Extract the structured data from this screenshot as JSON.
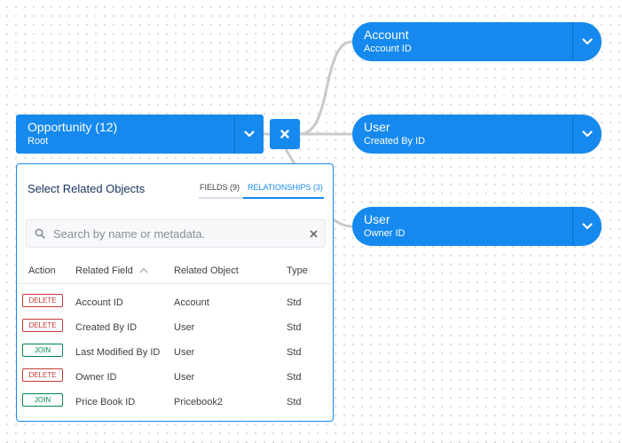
{
  "root_node": {
    "title": "Opportunity (12)",
    "subtitle": "Root"
  },
  "child_nodes": [
    {
      "title": "Account",
      "subtitle": "Account ID"
    },
    {
      "title": "User",
      "subtitle": "Created By ID"
    },
    {
      "title": "User",
      "subtitle": "Owner ID"
    }
  ],
  "panel": {
    "title": "Select Related Objects",
    "tabs": {
      "fields": "FIELDS (9)",
      "relationships": "RELATIONSHIPS (3)",
      "active": "relationships"
    },
    "search": {
      "placeholder": "Search by name or metadata.",
      "value": ""
    },
    "columns": {
      "action": "Action",
      "field": "Related Field",
      "object": "Related Object",
      "type": "Type"
    },
    "sort": {
      "column": "field",
      "direction": "ascending"
    },
    "rows": [
      {
        "action": "DELETE",
        "field": "Account ID",
        "object": "Account",
        "type": "Std"
      },
      {
        "action": "DELETE",
        "field": "Created By ID",
        "object": "User",
        "type": "Std"
      },
      {
        "action": "JOIN",
        "field": "Last Modified By ID",
        "object": "User",
        "type": "Std"
      },
      {
        "action": "DELETE",
        "field": "Owner ID",
        "object": "User",
        "type": "Std"
      },
      {
        "action": "JOIN",
        "field": "Price Book ID",
        "object": "Pricebook2",
        "type": "Std"
      }
    ]
  },
  "icons": {
    "chevron": "chevron-down-icon",
    "remove": "close-icon",
    "search": "search-icon",
    "clear": "clear-icon",
    "sort": "sort-ascending-icon"
  },
  "colors": {
    "node": "#1589ee",
    "delete": "#c23934",
    "join": "#04844b",
    "connector": "#c9c9c9"
  }
}
